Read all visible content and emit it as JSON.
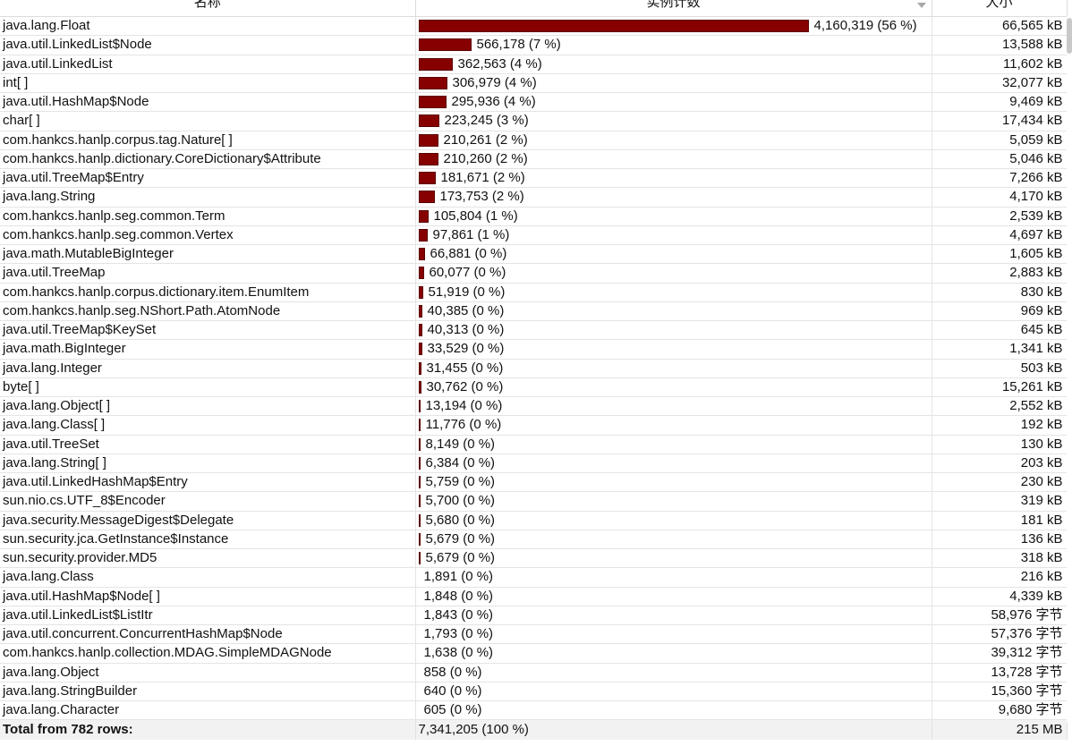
{
  "columns": {
    "name": "名称",
    "count": "实例计数",
    "size": "大小"
  },
  "rows": [
    {
      "name": "java.lang.Float",
      "count": "4,160,319 (56 %)",
      "size": "66,565 kB",
      "instances": 4160319
    },
    {
      "name": "java.util.LinkedList$Node",
      "count": "566,178 (7 %)",
      "size": "13,588 kB",
      "instances": 566178
    },
    {
      "name": "java.util.LinkedList",
      "count": "362,563 (4 %)",
      "size": "11,602 kB",
      "instances": 362563
    },
    {
      "name": "int[ ]",
      "count": "306,979 (4 %)",
      "size": "32,077 kB",
      "instances": 306979
    },
    {
      "name": "java.util.HashMap$Node",
      "count": "295,936 (4 %)",
      "size": "9,469 kB",
      "instances": 295936
    },
    {
      "name": "char[ ]",
      "count": "223,245 (3 %)",
      "size": "17,434 kB",
      "instances": 223245
    },
    {
      "name": "com.hankcs.hanlp.corpus.tag.Nature[ ]",
      "count": "210,261 (2 %)",
      "size": "5,059 kB",
      "instances": 210261
    },
    {
      "name": "com.hankcs.hanlp.dictionary.CoreDictionary$Attribute",
      "count": "210,260 (2 %)",
      "size": "5,046 kB",
      "instances": 210260
    },
    {
      "name": "java.util.TreeMap$Entry",
      "count": "181,671 (2 %)",
      "size": "7,266 kB",
      "instances": 181671
    },
    {
      "name": "java.lang.String",
      "count": "173,753 (2 %)",
      "size": "4,170 kB",
      "instances": 173753
    },
    {
      "name": "com.hankcs.hanlp.seg.common.Term",
      "count": "105,804 (1 %)",
      "size": "2,539 kB",
      "instances": 105804
    },
    {
      "name": "com.hankcs.hanlp.seg.common.Vertex",
      "count": "97,861 (1 %)",
      "size": "4,697 kB",
      "instances": 97861
    },
    {
      "name": "java.math.MutableBigInteger",
      "count": "66,881 (0 %)",
      "size": "1,605 kB",
      "instances": 66881
    },
    {
      "name": "java.util.TreeMap",
      "count": "60,077 (0 %)",
      "size": "2,883 kB",
      "instances": 60077
    },
    {
      "name": "com.hankcs.hanlp.corpus.dictionary.item.EnumItem",
      "count": "51,919 (0 %)",
      "size": "830 kB",
      "instances": 51919
    },
    {
      "name": "com.hankcs.hanlp.seg.NShort.Path.AtomNode",
      "count": "40,385 (0 %)",
      "size": "969 kB",
      "instances": 40385
    },
    {
      "name": "java.util.TreeMap$KeySet",
      "count": "40,313 (0 %)",
      "size": "645 kB",
      "instances": 40313
    },
    {
      "name": "java.math.BigInteger",
      "count": "33,529 (0 %)",
      "size": "1,341 kB",
      "instances": 33529
    },
    {
      "name": "java.lang.Integer",
      "count": "31,455 (0 %)",
      "size": "503 kB",
      "instances": 31455
    },
    {
      "name": "byte[ ]",
      "count": "30,762 (0 %)",
      "size": "15,261 kB",
      "instances": 30762
    },
    {
      "name": "java.lang.Object[ ]",
      "count": "13,194 (0 %)",
      "size": "2,552 kB",
      "instances": 13194
    },
    {
      "name": "java.lang.Class[ ]",
      "count": "11,776 (0 %)",
      "size": "192 kB",
      "instances": 11776
    },
    {
      "name": "java.util.TreeSet",
      "count": "8,149 (0 %)",
      "size": "130 kB",
      "instances": 8149
    },
    {
      "name": "java.lang.String[ ]",
      "count": "6,384 (0 %)",
      "size": "203 kB",
      "instances": 6384
    },
    {
      "name": "java.util.LinkedHashMap$Entry",
      "count": "5,759 (0 %)",
      "size": "230 kB",
      "instances": 5759
    },
    {
      "name": "sun.nio.cs.UTF_8$Encoder",
      "count": "5,700 (0 %)",
      "size": "319 kB",
      "instances": 5700
    },
    {
      "name": "java.security.MessageDigest$Delegate",
      "count": "5,680 (0 %)",
      "size": "181 kB",
      "instances": 5680
    },
    {
      "name": "sun.security.jca.GetInstance$Instance",
      "count": "5,679 (0 %)",
      "size": "136 kB",
      "instances": 5679
    },
    {
      "name": "sun.security.provider.MD5",
      "count": "5,679 (0 %)",
      "size": "318 kB",
      "instances": 5679
    },
    {
      "name": "java.lang.Class",
      "count": "1,891 (0 %)",
      "size": "216 kB",
      "instances": 1891
    },
    {
      "name": "java.util.HashMap$Node[ ]",
      "count": "1,848 (0 %)",
      "size": "4,339 kB",
      "instances": 1848
    },
    {
      "name": "java.util.LinkedList$ListItr",
      "count": "1,843 (0 %)",
      "size": "58,976 字节",
      "instances": 1843
    },
    {
      "name": "java.util.concurrent.ConcurrentHashMap$Node",
      "count": "1,793 (0 %)",
      "size": "57,376 字节",
      "instances": 1793
    },
    {
      "name": "com.hankcs.hanlp.collection.MDAG.SimpleMDAGNode",
      "count": "1,638 (0 %)",
      "size": "39,312 字节",
      "instances": 1638
    },
    {
      "name": "java.lang.Object",
      "count": "858 (0 %)",
      "size": "13,728 字节",
      "instances": 858
    },
    {
      "name": "java.lang.StringBuilder",
      "count": "640 (0 %)",
      "size": "15,360 字节",
      "instances": 640
    },
    {
      "name": "java.lang.Character",
      "count": "605 (0 %)",
      "size": "9,680 字节",
      "instances": 605
    }
  ],
  "footer": {
    "label": "Total from 782 rows:",
    "count": "7,341,205 (100 %)",
    "size": "215 MB"
  },
  "colors": {
    "bar": "#860000"
  },
  "icons": {
    "sort": "sort-descending-icon"
  }
}
